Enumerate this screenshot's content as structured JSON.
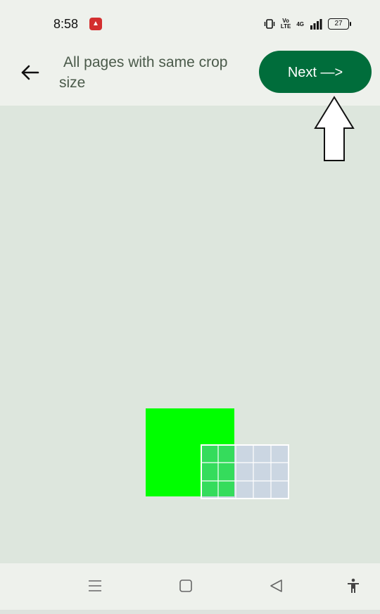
{
  "status_bar": {
    "time": "8:58",
    "volte": "Vo\nLTE",
    "network": "4G",
    "battery": "27"
  },
  "header": {
    "title": "All pages with same crop size",
    "next_label": "Next —>",
    "accent_color": "#006d3b"
  },
  "canvas": {
    "page_color": "#00ff00",
    "background_color": "#dde6dd"
  },
  "icons": {
    "back": "arrow-left-icon",
    "recents": "menu-lines-icon",
    "home": "square-home-icon",
    "nav_back": "triangle-back-icon",
    "accessibility": "accessibility-icon",
    "pointer": "up-arrow-pointer-icon"
  }
}
